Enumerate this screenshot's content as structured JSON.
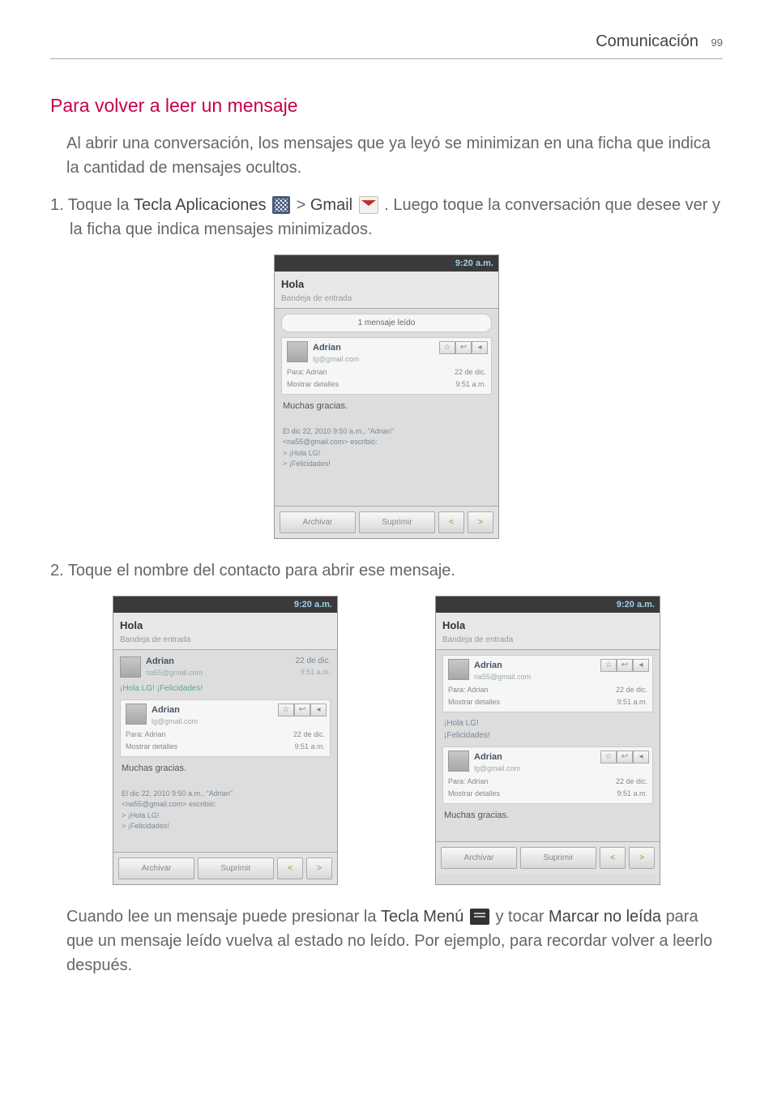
{
  "header": {
    "section": "Comunicación",
    "page": "99"
  },
  "heading": "Para volver a leer un mensaje",
  "intro": "Al abrir una conversación, los mensajes que ya leyó se minimizan en una ficha que indica la cantidad de mensajes ocultos.",
  "step1": {
    "num": "1.",
    "pre": "Toque la ",
    "apps_label": "Tecla Aplicaciones",
    "gt": " > ",
    "gmail_label": "Gmail",
    "post": ". Luego toque la conversación que desee ver y la ficha que indica mensajes minimizados."
  },
  "step2": {
    "num": "2.",
    "text": "Toque el nombre del contacto para abrir ese mensaje."
  },
  "closing": {
    "pre": "Cuando lee un mensaje puede presionar la ",
    "menu_label": "Tecla Menú",
    "mid": " y tocar ",
    "mark_label": "Marcar no leída",
    "post": " para que un mensaje leído vuelva al estado no leído. Por ejemplo, para recordar volver a leerlo después."
  },
  "phone": {
    "status_time": "9:20 a.m.",
    "title": "Hola",
    "subtitle": "Bandeja de entrada",
    "read_count": "1 mensaje leído",
    "sender": "Adrian",
    "email1": "lg@gmail.com",
    "email2": "na55@gmail.com",
    "email3": "lg@gmail.com",
    "para": "Para: Adrian",
    "mostrar": "Mostrar detalles",
    "date_short": "22 de dic.",
    "time_short": "9:51 a.m.",
    "body_first": "Muchas gracias.",
    "body_meta": "El dic 22, 2010 9:50 a.m., \"Adrian\"",
    "body_from": "<na55@gmail.com> escribió:",
    "body_q1": "> ¡Hola LG!",
    "body_q2": "> ¡Felicidades!",
    "preview1": "¡Hola LG! ¡Felicidades!",
    "preview2_a": "¡Hola LG!",
    "preview2_b": "¡Felicidades!",
    "archivar": "Archivar",
    "suprimir": "Suprimir",
    "prev": "<",
    "next": ">",
    "star": "☆",
    "reply": "↩",
    "more": "◂"
  }
}
